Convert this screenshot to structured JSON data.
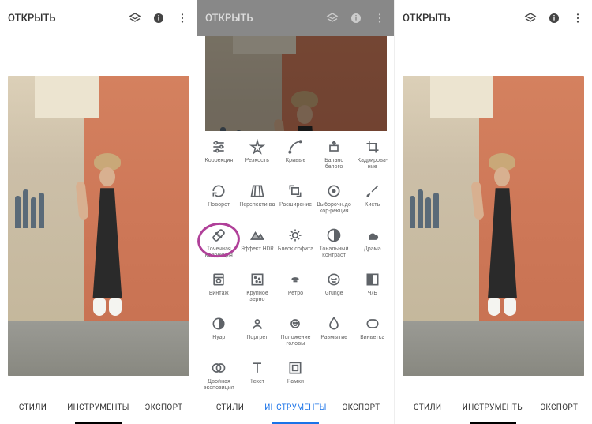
{
  "header": {
    "open_label": "ОТКРЫТЬ"
  },
  "tabs": {
    "styles": "СТИЛИ",
    "tools": "ИНСТРУМЕНТЫ",
    "export": "ЭКСПОРТ"
  },
  "tools": {
    "row1": [
      {
        "name": "tune",
        "label": "Коррекция"
      },
      {
        "name": "details",
        "label": "Резкость"
      },
      {
        "name": "curves",
        "label": "Кривые"
      },
      {
        "name": "white-balance",
        "label": "Баланс белого"
      },
      {
        "name": "crop",
        "label": "Кадрирова-ние"
      }
    ],
    "row2": [
      {
        "name": "rotate",
        "label": "Поворот"
      },
      {
        "name": "perspective",
        "label": "Перспекти-ва"
      },
      {
        "name": "expand",
        "label": "Расширение"
      },
      {
        "name": "selective",
        "label": "Выборочн.до кор-рекция"
      },
      {
        "name": "brush",
        "label": "Кисть"
      }
    ],
    "row3": [
      {
        "name": "healing",
        "label": "Точечная коррекция"
      },
      {
        "name": "hdr",
        "label": "Эффект HDR"
      },
      {
        "name": "glamour",
        "label": "Блеск софита"
      },
      {
        "name": "tonal",
        "label": "Тональный контраст"
      },
      {
        "name": "drama",
        "label": "Драма"
      }
    ],
    "row4": [
      {
        "name": "vintage",
        "label": "Винтаж"
      },
      {
        "name": "grainy",
        "label": "Крупное зерно"
      },
      {
        "name": "retro",
        "label": "Ретро"
      },
      {
        "name": "grunge",
        "label": "Grunge"
      },
      {
        "name": "bw",
        "label": "Ч/Б"
      }
    ],
    "row5": [
      {
        "name": "noir",
        "label": "Нуар"
      },
      {
        "name": "portrait",
        "label": "Портрет"
      },
      {
        "name": "head-pose",
        "label": "Положение головы"
      },
      {
        "name": "blur",
        "label": "Размытие"
      },
      {
        "name": "vignette",
        "label": "Виньетка"
      }
    ],
    "row6": [
      {
        "name": "double-exp",
        "label": "Двойная экспозиция"
      },
      {
        "name": "text",
        "label": "Текст"
      },
      {
        "name": "frames",
        "label": "Рамки"
      }
    ]
  }
}
